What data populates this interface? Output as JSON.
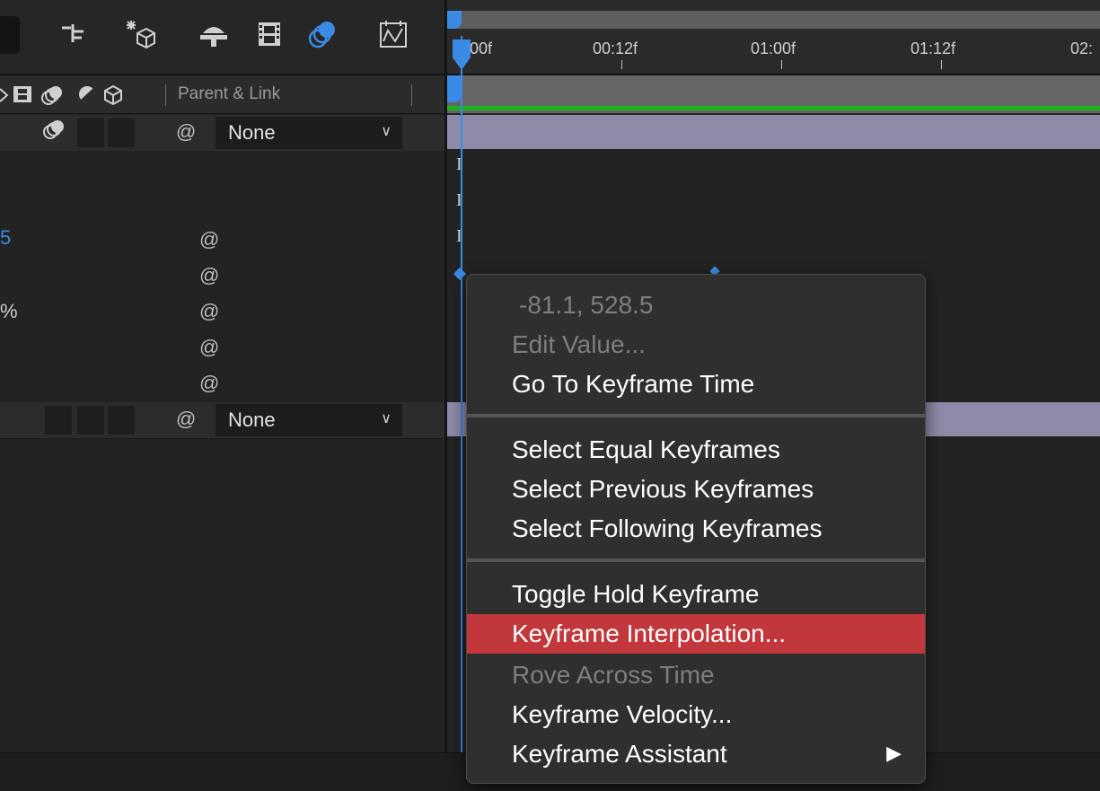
{
  "left_panel": {
    "parent_link_label": "Parent & Link",
    "layers": [
      {
        "parent_value": "None"
      },
      {
        "parent_value": "None"
      }
    ],
    "property_values": [
      "",
      "",
      "5",
      "",
      "%",
      "",
      ""
    ]
  },
  "timeline": {
    "tick_labels": [
      "0:00f",
      "00:12f",
      "01:00f",
      "01:12f",
      "02:"
    ]
  },
  "context_menu": {
    "value_readout": "-81.1, 528.5",
    "items": {
      "edit_value": "Edit Value...",
      "go_to_keyframe_time": "Go To Keyframe Time",
      "select_equal": "Select Equal Keyframes",
      "select_previous": "Select Previous Keyframes",
      "select_following": "Select Following Keyframes",
      "toggle_hold": "Toggle Hold Keyframe",
      "keyframe_interpolation": "Keyframe Interpolation...",
      "rove_across_time": "Rove Across Time",
      "keyframe_velocity": "Keyframe Velocity...",
      "keyframe_assistant": "Keyframe Assistant"
    },
    "highlighted_item": "Keyframe Interpolation...",
    "disabled_items": [
      "-81.1, 528.5",
      "Edit Value...",
      "Rove Across Time"
    ]
  },
  "colors": {
    "highlight": "#c1373b",
    "time_indicator": "#3b8ae6",
    "work_area": "#1db21d",
    "layer_bar": "#8e8aa8"
  },
  "icons": [
    "shy-layers-icon",
    "collapse-transformations-icon",
    "draft-3d-icon",
    "frame-blending-icon",
    "motion-blur-icon",
    "graph-editor-icon",
    "pick-whip-icon",
    "submenu-arrow-icon",
    "current-time-indicator-icon"
  ]
}
